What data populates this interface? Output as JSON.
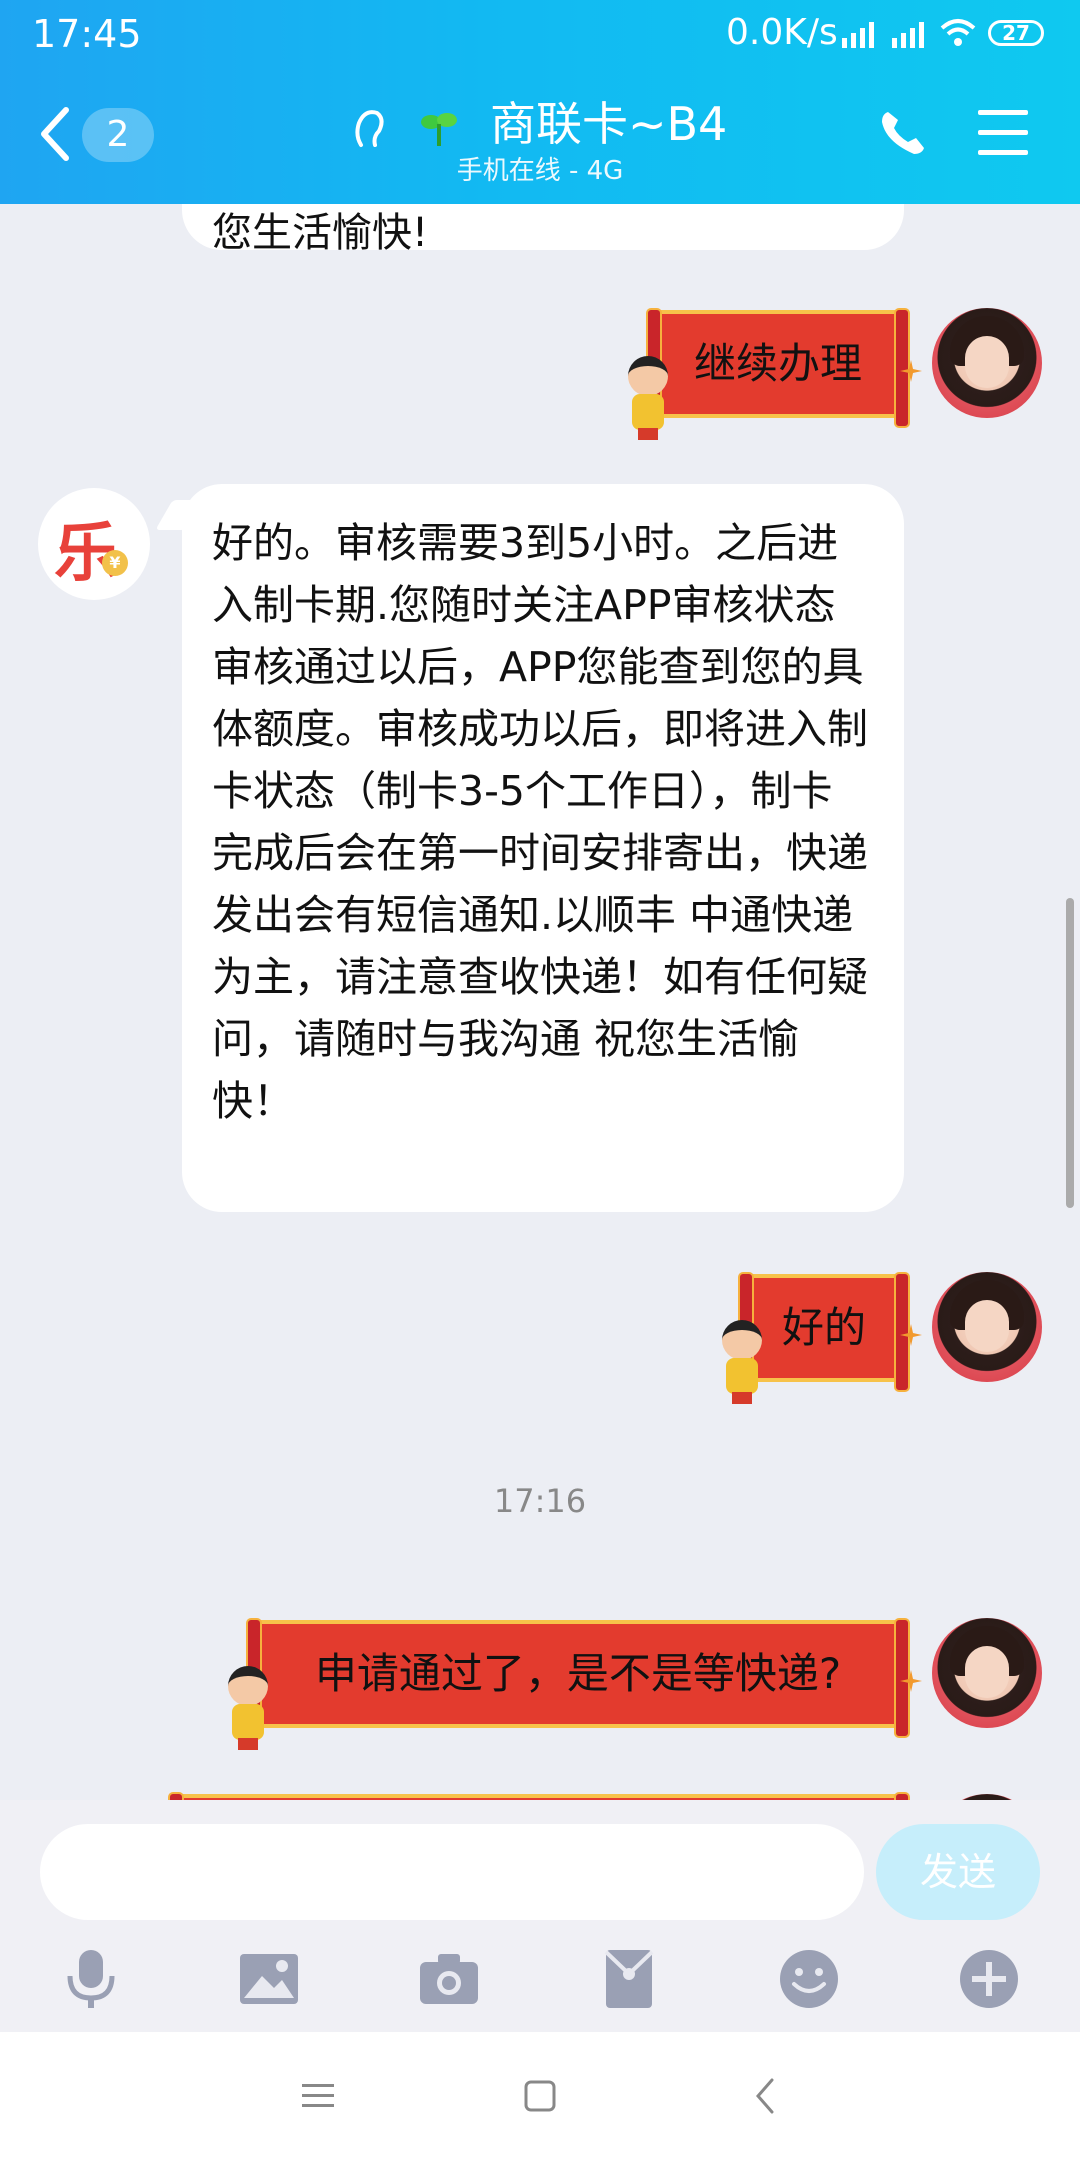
{
  "status_bar": {
    "time": "17:45",
    "net_speed": "0.0K/s",
    "battery": "27"
  },
  "header": {
    "unread_count": "2",
    "contact_name": "商联卡~B4",
    "contact_status": "手机在线 - 4G",
    "icons": [
      "back-icon",
      "ear-icon",
      "leaf-icon",
      "phone-icon",
      "menu-icon"
    ]
  },
  "messages": {
    "peek_text": "您生活愉快!",
    "m1": "继续办理",
    "m2": "好的。审核需要3到5小时。之后进入制卡期.您随时关注APP审核状态  审核通过以后，APP您能查到您的具体额度。审核成功以后，即将进入制卡状态（制卡3-5个工作日），制卡完成后会在第一时间安排寄出，快递发出会有短信通知.以顺丰 中通快递为主，请注意查收快递！如有任何疑问，请随时与我沟通 祝您生活愉快！",
    "m3": "好的",
    "time_divider": "17:16",
    "m4": "申请通过了，是不是等快递?"
  },
  "avatar_logo": {
    "char": "乐",
    "coin": "¥"
  },
  "input_bar": {
    "placeholder": "",
    "send_label": "发送",
    "icons": [
      "microphone-icon",
      "image-icon",
      "camera-icon",
      "red-packet-icon",
      "emoji-icon",
      "plus-icon"
    ]
  },
  "nav_bar": {
    "icons": [
      "menu-nav-icon",
      "home-nav-icon",
      "back-nav-icon"
    ]
  },
  "colors": {
    "header_start": "#1fa5f2",
    "header_end": "#0fc9f0",
    "card_red": "#e33b2e",
    "card_gold": "#f7c24a",
    "send_bg": "#c6eefb",
    "chat_bg": "#eceef4"
  }
}
